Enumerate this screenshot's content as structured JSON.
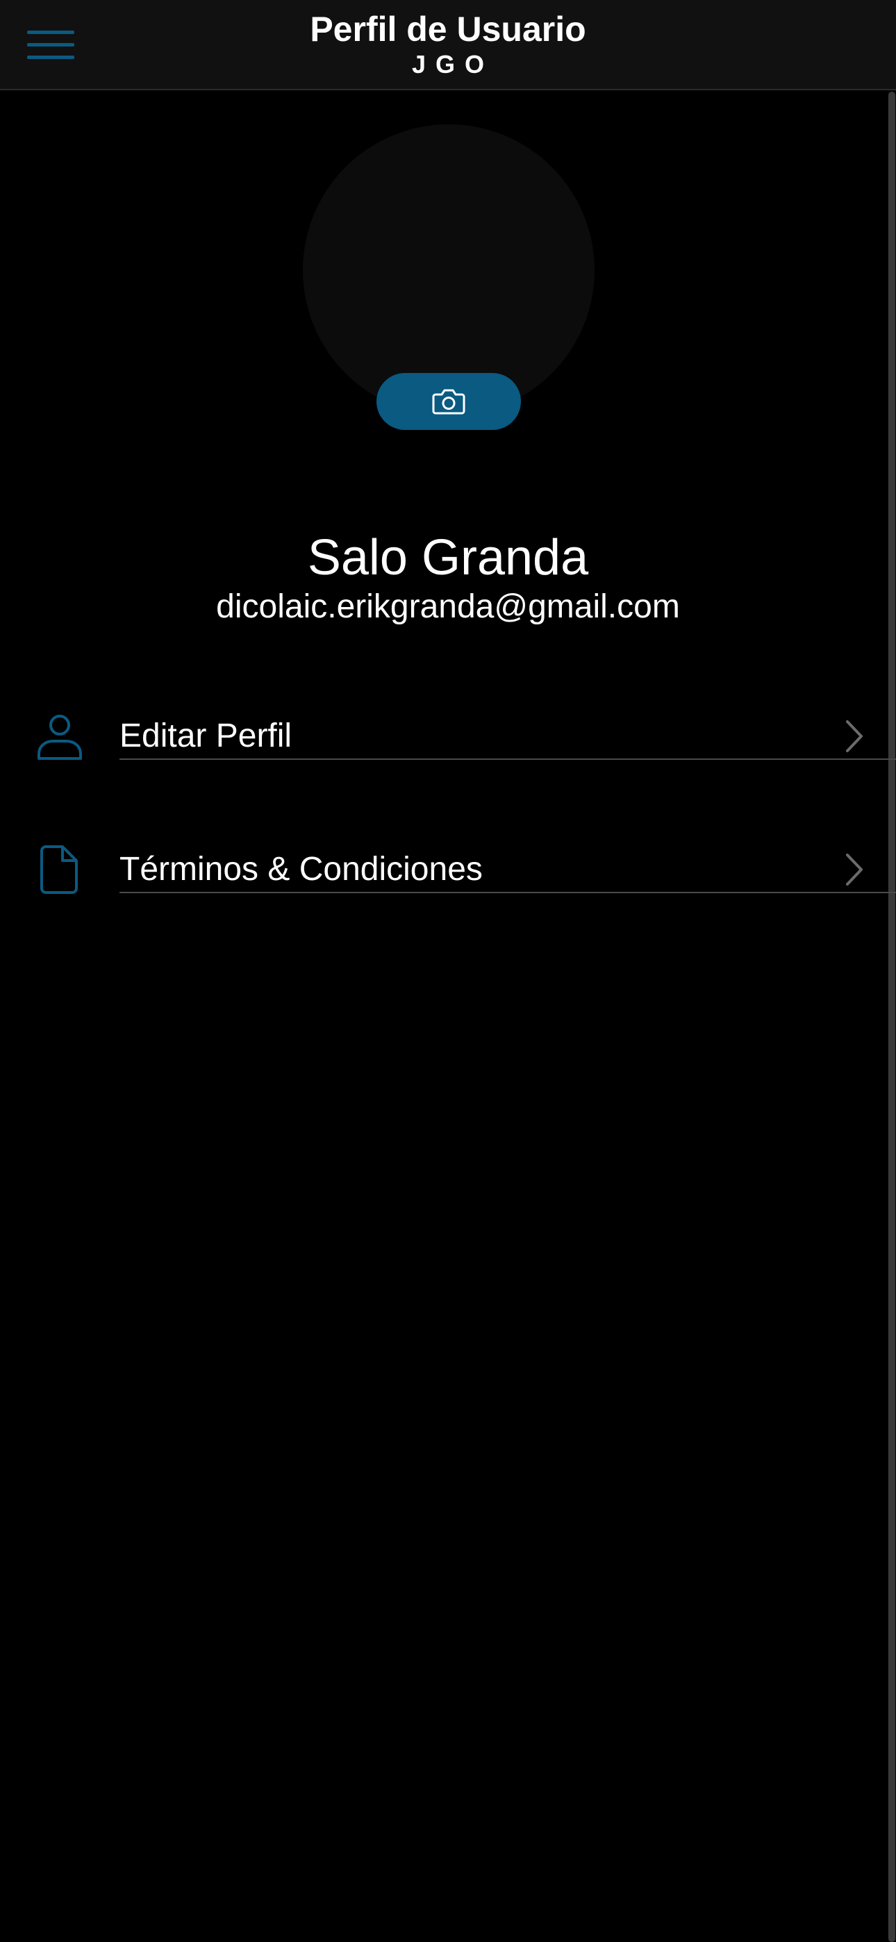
{
  "header": {
    "title": "Perfil de Usuario",
    "subtitle": "JGO",
    "menu_icon": "hamburger-menu-icon"
  },
  "colors": {
    "background": "#000000",
    "header_background": "#111111",
    "accent": "#0a5a82",
    "divider": "#4a4a4a",
    "chevron": "#6b6b6b",
    "avatar_placeholder": "#0c0c0c"
  },
  "profile": {
    "name": "Salo Granda",
    "email": "dicolaic.erikgranda@gmail.com",
    "camera_icon": "camera-icon"
  },
  "menu": {
    "items": [
      {
        "label": "Editar Perfil",
        "icon": "user-icon",
        "trailing_icon": "chevron-right-icon"
      },
      {
        "label": "Términos & Condiciones",
        "icon": "document-icon",
        "trailing_icon": "chevron-right-icon"
      }
    ]
  }
}
